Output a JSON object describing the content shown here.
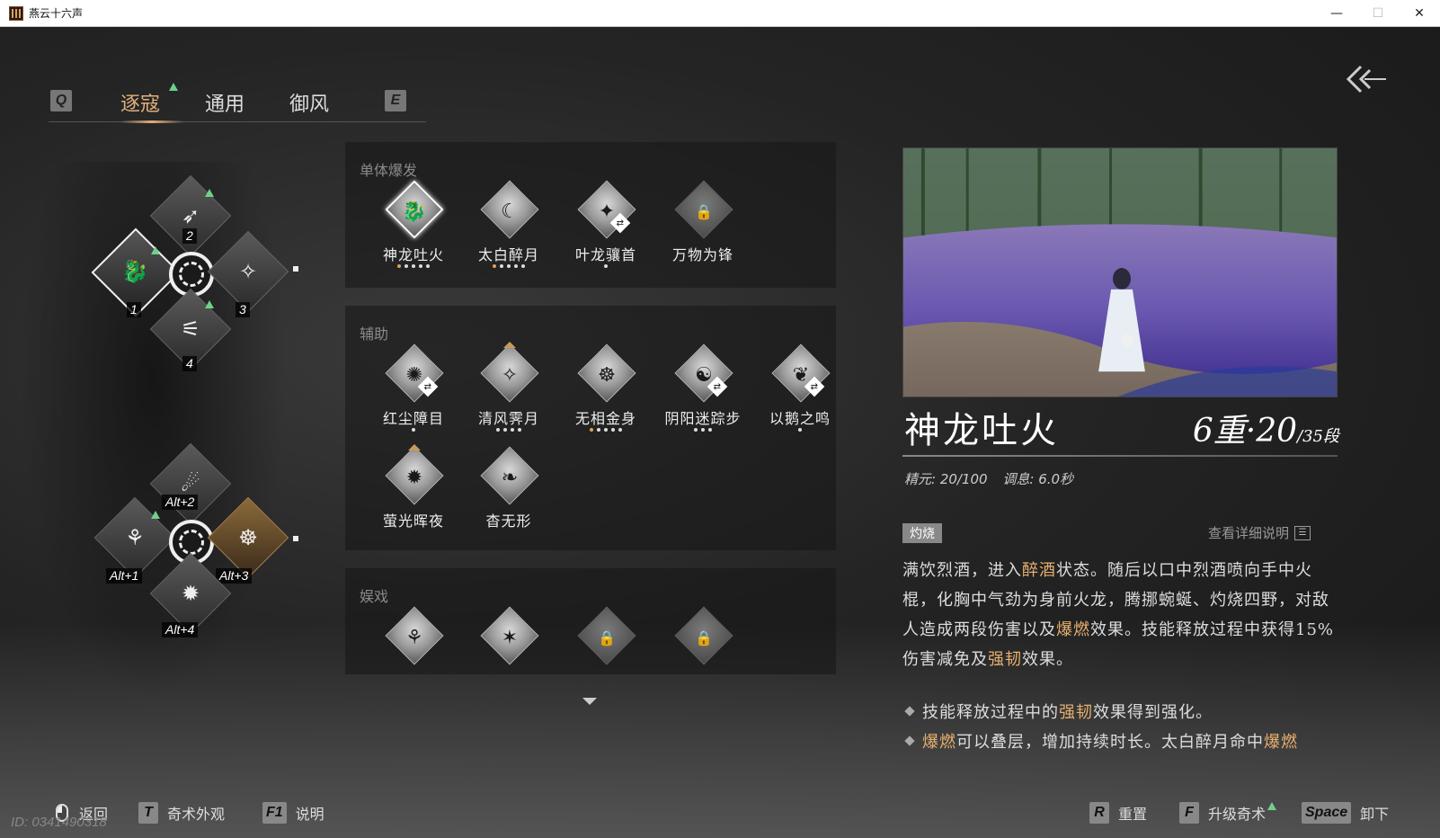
{
  "window": {
    "title": "燕云十六声",
    "min": "—",
    "max": "☐",
    "close": "✕"
  },
  "tabs": {
    "left_key": "Q",
    "right_key": "E",
    "items": [
      {
        "label": "逐寇",
        "active": true
      },
      {
        "label": "通用",
        "active": false
      },
      {
        "label": "御风",
        "active": false
      }
    ]
  },
  "wheel_primary": {
    "labels": [
      "1",
      "2",
      "3",
      "4"
    ]
  },
  "wheel_secondary": {
    "labels": [
      "Alt+1",
      "Alt+2",
      "Alt+3",
      "Alt+4"
    ]
  },
  "sections": [
    {
      "title": "单体爆发",
      "skills": [
        {
          "name": "神龙吐火",
          "glyph": "🐉",
          "dots": 5,
          "dots_on": 1,
          "selected": true
        },
        {
          "name": "太白醉月",
          "glyph": "☾",
          "dots": 5,
          "dots_on": 1
        },
        {
          "name": "叶龙骧首",
          "glyph": "✦",
          "dots": 1,
          "dots_on": 0,
          "swap": true
        },
        {
          "name": "万物为锋",
          "glyph": "🔒",
          "dots": 0,
          "dots_on": 0,
          "locked": true
        }
      ]
    },
    {
      "title": "辅助",
      "skills": [
        {
          "name": "红尘障目",
          "glyph": "✺",
          "dots": 1,
          "dots_on": 0,
          "swap": true
        },
        {
          "name": "清风霁月",
          "glyph": "✧",
          "dots": 4,
          "dots_on": 0,
          "gold": true
        },
        {
          "name": "无相金身",
          "glyph": "☸",
          "dots": 5,
          "dots_on": 1
        },
        {
          "name": "阴阳迷踪步",
          "glyph": "☯",
          "dots": 3,
          "dots_on": 0,
          "swap": true
        },
        {
          "name": "以鹅之鸣",
          "glyph": "❦",
          "dots": 1,
          "dots_on": 0,
          "swap": true
        },
        {
          "name": "萤光晖夜",
          "glyph": "✹",
          "dots": 0,
          "dots_on": 0,
          "gold": true
        },
        {
          "name": "杳无形",
          "glyph": "❧",
          "dots": 0,
          "dots_on": 0
        }
      ]
    },
    {
      "title": "娱戏",
      "skills": [
        {
          "name": "",
          "glyph": "⚘",
          "dots": 0,
          "dots_on": 0
        },
        {
          "name": "",
          "glyph": "✶",
          "dots": 0,
          "dots_on": 0
        },
        {
          "name": "",
          "glyph": "🔒",
          "dots": 0,
          "dots_on": 0,
          "locked": true
        },
        {
          "name": "",
          "glyph": "🔒",
          "dots": 0,
          "dots_on": 0,
          "locked": true
        }
      ]
    }
  ],
  "detail": {
    "name": "神龙吐火",
    "level_big": "6重·20",
    "level_small": "/35段",
    "stat1": "精元: 20/100",
    "stat2": "调息: 6.0秒",
    "tag": "灼烧",
    "more": "查看详细说明",
    "desc_html_parts": [
      {
        "t": "满饮烈酒，进入"
      },
      {
        "t": "醉酒",
        "hl": true
      },
      {
        "t": "状态。随后以口中烈酒喷向手中火棍，化胸中气劲为身前火龙，腾挪蜿蜒、灼烧四野，对敌人造成两段伤害以及"
      },
      {
        "t": "爆燃",
        "hl": true
      },
      {
        "t": "效果。技能释放过程中获得15%伤害减免及"
      },
      {
        "t": "强韧",
        "hl": true
      },
      {
        "t": "效果。"
      }
    ],
    "bullets": [
      [
        {
          "t": "技能释放过程中的"
        },
        {
          "t": "强韧",
          "hl": true
        },
        {
          "t": "效果得到强化。"
        }
      ],
      [
        {
          "t": "爆燃",
          "hl": true
        },
        {
          "t": "可以叠层，增加持续时长。太白醉月命中"
        },
        {
          "t": "爆燃",
          "hl": true
        }
      ]
    ]
  },
  "bottom": {
    "back": "返回",
    "appearance_key": "T",
    "appearance": "奇术外观",
    "help_key": "F1",
    "help": "说明",
    "reset_key": "R",
    "reset": "重置",
    "upgrade_key": "F",
    "upgrade": "升级奇术",
    "unload_key": "Space",
    "unload": "卸下",
    "id_text": "ID: 0341490318"
  },
  "colors": {
    "accent": "#e0b07a",
    "highlight": "#e8b070",
    "new_marker": "#6fd08a"
  }
}
